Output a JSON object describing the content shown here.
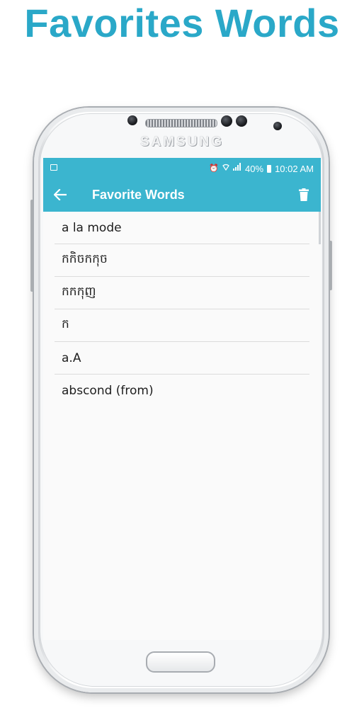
{
  "headline": "Favorites Words",
  "device": {
    "brand": "SAMSUNG"
  },
  "status_bar": {
    "icons": [
      "image-icon",
      "alarm-icon",
      "wifi-icon",
      "signal-icon",
      "battery-icon"
    ],
    "battery": "40%",
    "time": "10:02 AM"
  },
  "app_bar": {
    "title": "Favorite Words",
    "back_icon": "arrow-back-icon",
    "delete_icon": "trash-icon",
    "color": "#3bb5cf"
  },
  "favorites": [
    {
      "word": "a la mode"
    },
    {
      "word": "កកិចកកុច"
    },
    {
      "word": "កកកុញ"
    },
    {
      "word": "ក"
    },
    {
      "word": "a.A"
    },
    {
      "word": "abscond (from)"
    }
  ],
  "colors": {
    "accent": "#3bb5cf",
    "headline": "#2aa8c8"
  }
}
